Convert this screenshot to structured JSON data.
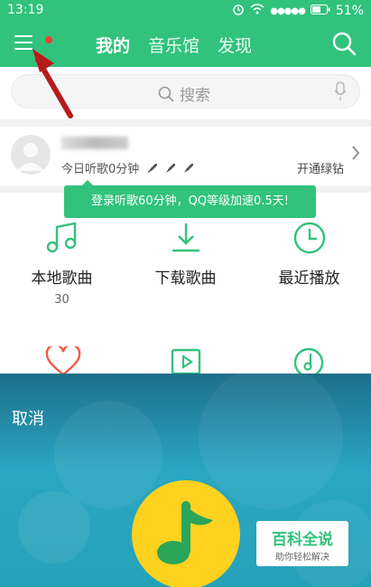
{
  "status_bar": {
    "time": "13:19",
    "battery": "51%"
  },
  "nav": {
    "tabs": [
      "我的",
      "音乐馆",
      "发现"
    ],
    "active_tab": "我的"
  },
  "search": {
    "placeholder": "搜索"
  },
  "profile": {
    "listen_today": "今日听歌0分钟",
    "vip": "开通绿钻"
  },
  "toast": {
    "text": "登录听歌60分钟，QQ等级加速0.5天!"
  },
  "grid": [
    {
      "label": "本地歌曲",
      "count": "30",
      "icon": "music-note-icon"
    },
    {
      "label": "下载歌曲",
      "icon": "download-icon"
    },
    {
      "label": "最近播放",
      "icon": "clock-icon"
    }
  ],
  "overlay": {
    "cancel": "取消"
  },
  "watermark": {
    "title": "百科全说",
    "subtitle": "助你轻松解决"
  },
  "colors": {
    "accent": "#31c27c",
    "overlay": "#2aa6c2",
    "logo": "#ffd21f",
    "arrow": "#b71c1c"
  }
}
